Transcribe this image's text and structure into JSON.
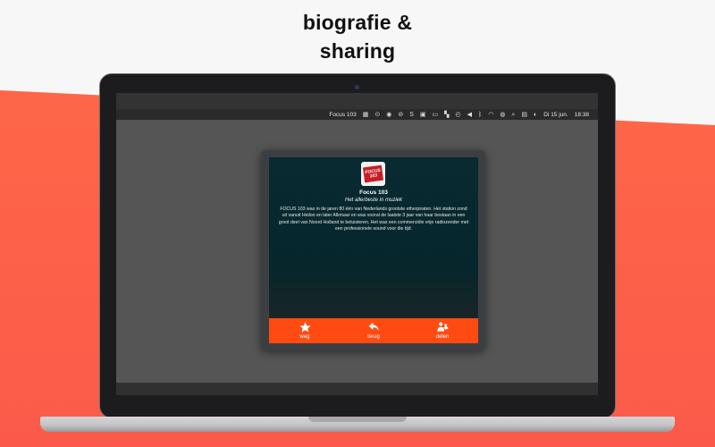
{
  "headline": {
    "line1": "biografie &",
    "line2": "sharing"
  },
  "menubar": {
    "app_name": "Focus 103",
    "icons": [
      "grid-icon",
      "play-circle-icon",
      "record-icon",
      "pause-circle-icon",
      "s-icon",
      "display-icon",
      "ruler-icon",
      "tiles-icon",
      "clock-icon",
      "volume-icon",
      "bluetooth-icon",
      "wifi-icon",
      "user-icon",
      "search-icon",
      "flag-icon",
      "control-icon"
    ],
    "date": "Di 15 jun.",
    "time": "18:38"
  },
  "app": {
    "logo_text_top": "FOCUS",
    "logo_text_bottom": "103",
    "station_name": "Focus 103",
    "tagline": "Het allerbeste in muziek",
    "bio": "FOCUS 103 was in de jaren 80 één van Nederlands grootste etherpiraten. Het station zond uit vanuit Heiloo en later Alkmaar en was vooral de laatste 3 jaar van haar bestaan in een groot deel van Noord Holland te beluisteren. Het was een commerciële vrije radiozender met een professionele sound voor die tijd.",
    "tabs": [
      {
        "label": "weg",
        "icon": "star-icon"
      },
      {
        "label": "terug",
        "icon": "back-arrow-icon"
      },
      {
        "label": "delen",
        "icon": "share-icon"
      }
    ],
    "accent_color": "#ff4b12"
  }
}
